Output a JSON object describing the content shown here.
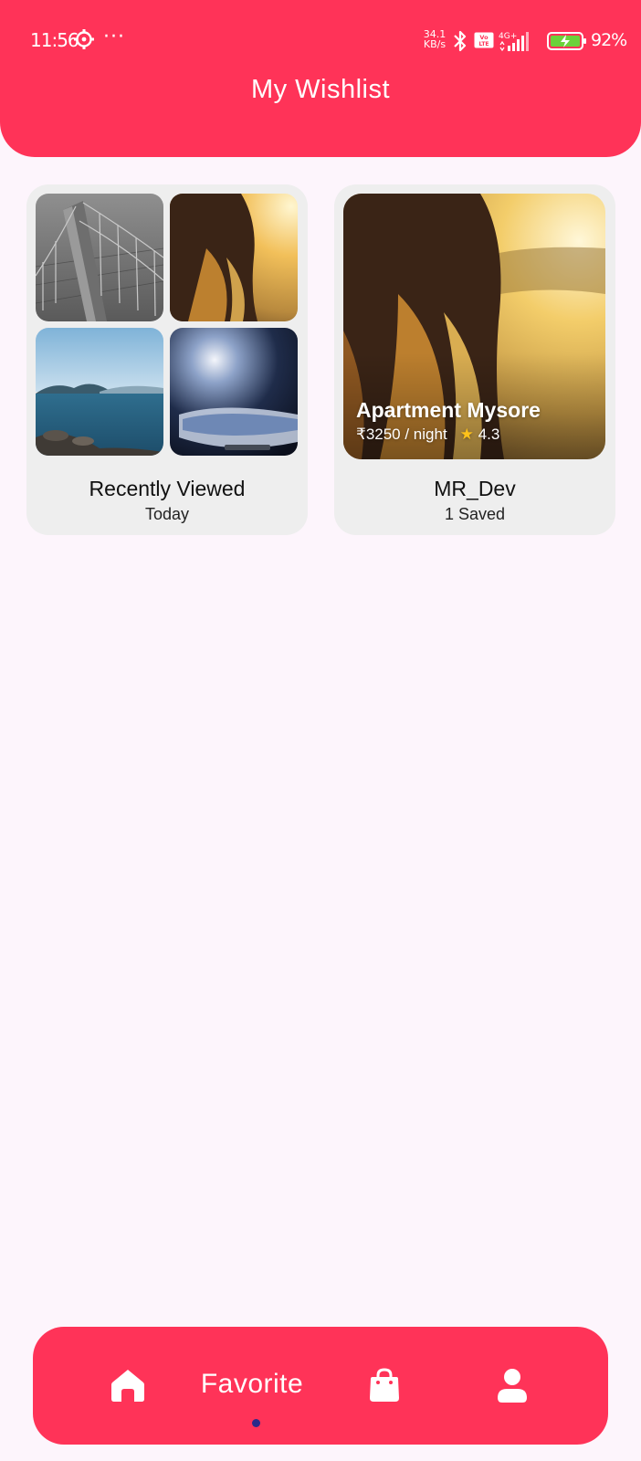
{
  "status_bar": {
    "time": "11:56",
    "more": "···",
    "net_speed_value": "34.1",
    "net_speed_unit": "KB/s",
    "volte": "Vo LTE",
    "network": "4G+",
    "battery_percent": "92%"
  },
  "header": {
    "title": "My Wishlist"
  },
  "wishlists": [
    {
      "title": "Recently Viewed",
      "subtitle": "Today"
    },
    {
      "title": "MR_Dev",
      "subtitle": "1 Saved",
      "listing": {
        "name": "Apartment Mysore",
        "price": "₹3250 / night",
        "rating": "4.3"
      }
    }
  ],
  "bottom_nav": {
    "items": [
      {
        "icon": "home-icon"
      },
      {
        "label": "Favorite"
      },
      {
        "icon": "shopping-bag-icon"
      },
      {
        "icon": "profile-icon"
      }
    ]
  },
  "colors": {
    "accent": "#ff3358",
    "background": "#fdf5fc",
    "card": "#eeeeee",
    "active_dot": "#2a2a8a",
    "star": "#ffc21a"
  }
}
